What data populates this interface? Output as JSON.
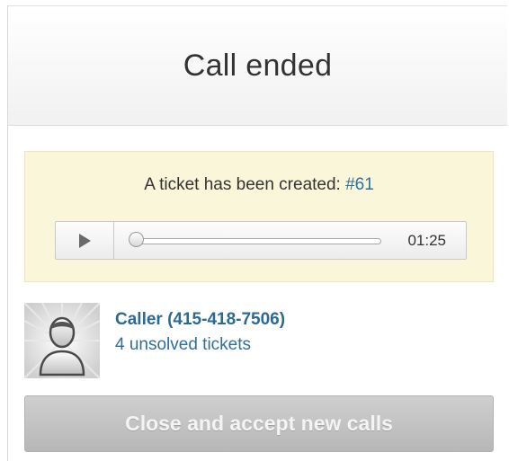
{
  "header": {
    "title": "Call ended"
  },
  "notice": {
    "text": "A ticket has been created: ",
    "ticket_link": "#61"
  },
  "player": {
    "play_icon": "play-icon",
    "time": "01:25",
    "progress": 0
  },
  "caller": {
    "avatar_icon": "default-user-avatar",
    "name": "Caller (415-418-7506)",
    "unsolved_tickets": "4 unsolved tickets"
  },
  "actions": {
    "close_label": "Close and accept new calls"
  },
  "colors": {
    "notice_bg": "#faf6d9",
    "link": "#2e6fa0",
    "button_bg": "#c4c4c4"
  }
}
